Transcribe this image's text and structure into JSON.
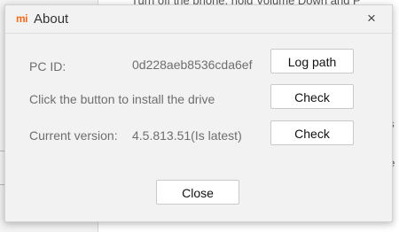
{
  "background": {
    "top_text": "Turn off the phone, hold Volume Down and P",
    "right_fragments": [
      "es",
      "e:",
      "he"
    ]
  },
  "dialog": {
    "logo_text": "mi",
    "title": "About",
    "close_glyph": "×",
    "pc_id_label": "PC ID:",
    "pc_id_value": "0d228aeb8536cda6ef",
    "log_path_button": "Log path",
    "install_text": "Click the button to install the drive",
    "check_button_1": "Check",
    "version_label": "Current version:",
    "version_value": "4.5.813.51(Is latest)",
    "check_button_2": "Check",
    "close_button": "Close"
  },
  "colors": {
    "brand_orange": "#f26a1b"
  }
}
